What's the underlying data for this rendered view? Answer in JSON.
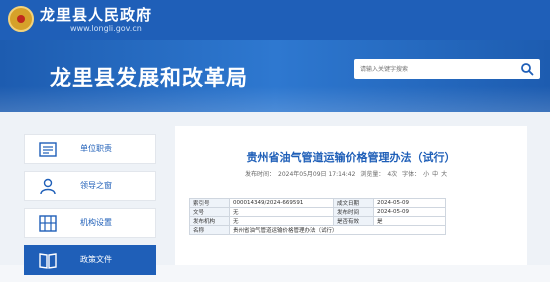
{
  "site": {
    "gov_name": "龙里县人民政府",
    "gov_url": "www.longli.gov.cn",
    "bureau_name": "龙里县发展和改革局"
  },
  "search": {
    "placeholder": "请输入关键字搜索"
  },
  "sidebar": {
    "items": [
      {
        "label": "单位职责",
        "icon": "document-icon",
        "active": false
      },
      {
        "label": "领导之窗",
        "icon": "person-icon",
        "active": false
      },
      {
        "label": "机构设置",
        "icon": "org-chart-icon",
        "active": false
      },
      {
        "label": "政策文件",
        "icon": "book-icon",
        "active": true
      }
    ]
  },
  "article": {
    "title": "贵州省油气管道运输价格管理办法（试行）",
    "publish_label": "发布时间：",
    "publish_time": "2024年05月09日 17:14:42",
    "views_label": "浏览量：",
    "views": "4次",
    "font_label": "字体：",
    "font_small": "小",
    "font_medium": "中",
    "font_large": "大"
  },
  "info": {
    "index_label": "索引号",
    "index_value": "000014349/2024-669591",
    "written_label": "成文日期",
    "written_value": "2024-05-09",
    "docno_label": "文号",
    "docno_value": "无",
    "pub_label": "发布时间",
    "pub_value": "2024-05-09",
    "org_label": "发布机构",
    "org_value": "无",
    "valid_label": "是否有效",
    "valid_value": "是",
    "name_label": "名称",
    "name_value": "贵州省油气管道运输价格管理办法（试行）"
  },
  "colors": {
    "brand_blue": "#1f5fb8",
    "banner_blue": "#2e78d0",
    "emblem_gold": "#d6a12a"
  }
}
